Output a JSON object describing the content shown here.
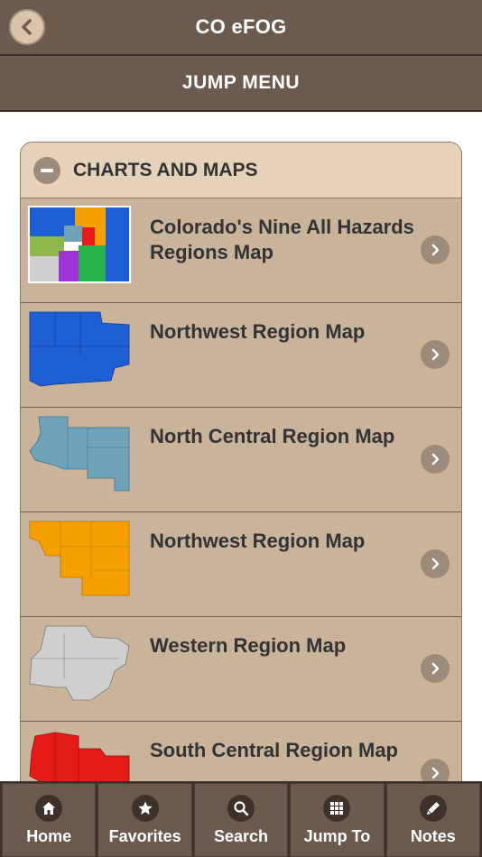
{
  "header": {
    "title": "CO eFOG"
  },
  "subheader": {
    "label": "JUMP MENU"
  },
  "panel": {
    "title": "CHARTS AND MAPS",
    "items": [
      {
        "label": "Colorado's Nine All Hazards Regions Map",
        "thumb": "colorado-regions-map"
      },
      {
        "label": "Northwest Region Map",
        "thumb": "northwest-region-map"
      },
      {
        "label": "North Central Region Map",
        "thumb": "north-central-region-map"
      },
      {
        "label": "Northwest Region Map",
        "thumb": "northeast-region-map"
      },
      {
        "label": "Western Region Map",
        "thumb": "western-region-map"
      },
      {
        "label": "South Central Region Map",
        "thumb": "south-central-region-map"
      }
    ]
  },
  "tabbar": {
    "tabs": [
      {
        "label": "Home",
        "icon": "home-icon"
      },
      {
        "label": "Favorites",
        "icon": "star-icon"
      },
      {
        "label": "Search",
        "icon": "search-icon"
      },
      {
        "label": "Jump To",
        "icon": "grid-icon"
      },
      {
        "label": "Notes",
        "icon": "pencil-icon"
      }
    ]
  },
  "colors": {
    "bar": "#6b5a4d",
    "panel_header": "#e6d2ba",
    "list_bg": "#c9b39a",
    "text_dark": "#333333",
    "map_blue": "#1f5fd6",
    "map_teal": "#6fa3b8",
    "map_orange": "#f5a000",
    "map_gray": "#cfcfcf",
    "map_red": "#e41b17"
  }
}
